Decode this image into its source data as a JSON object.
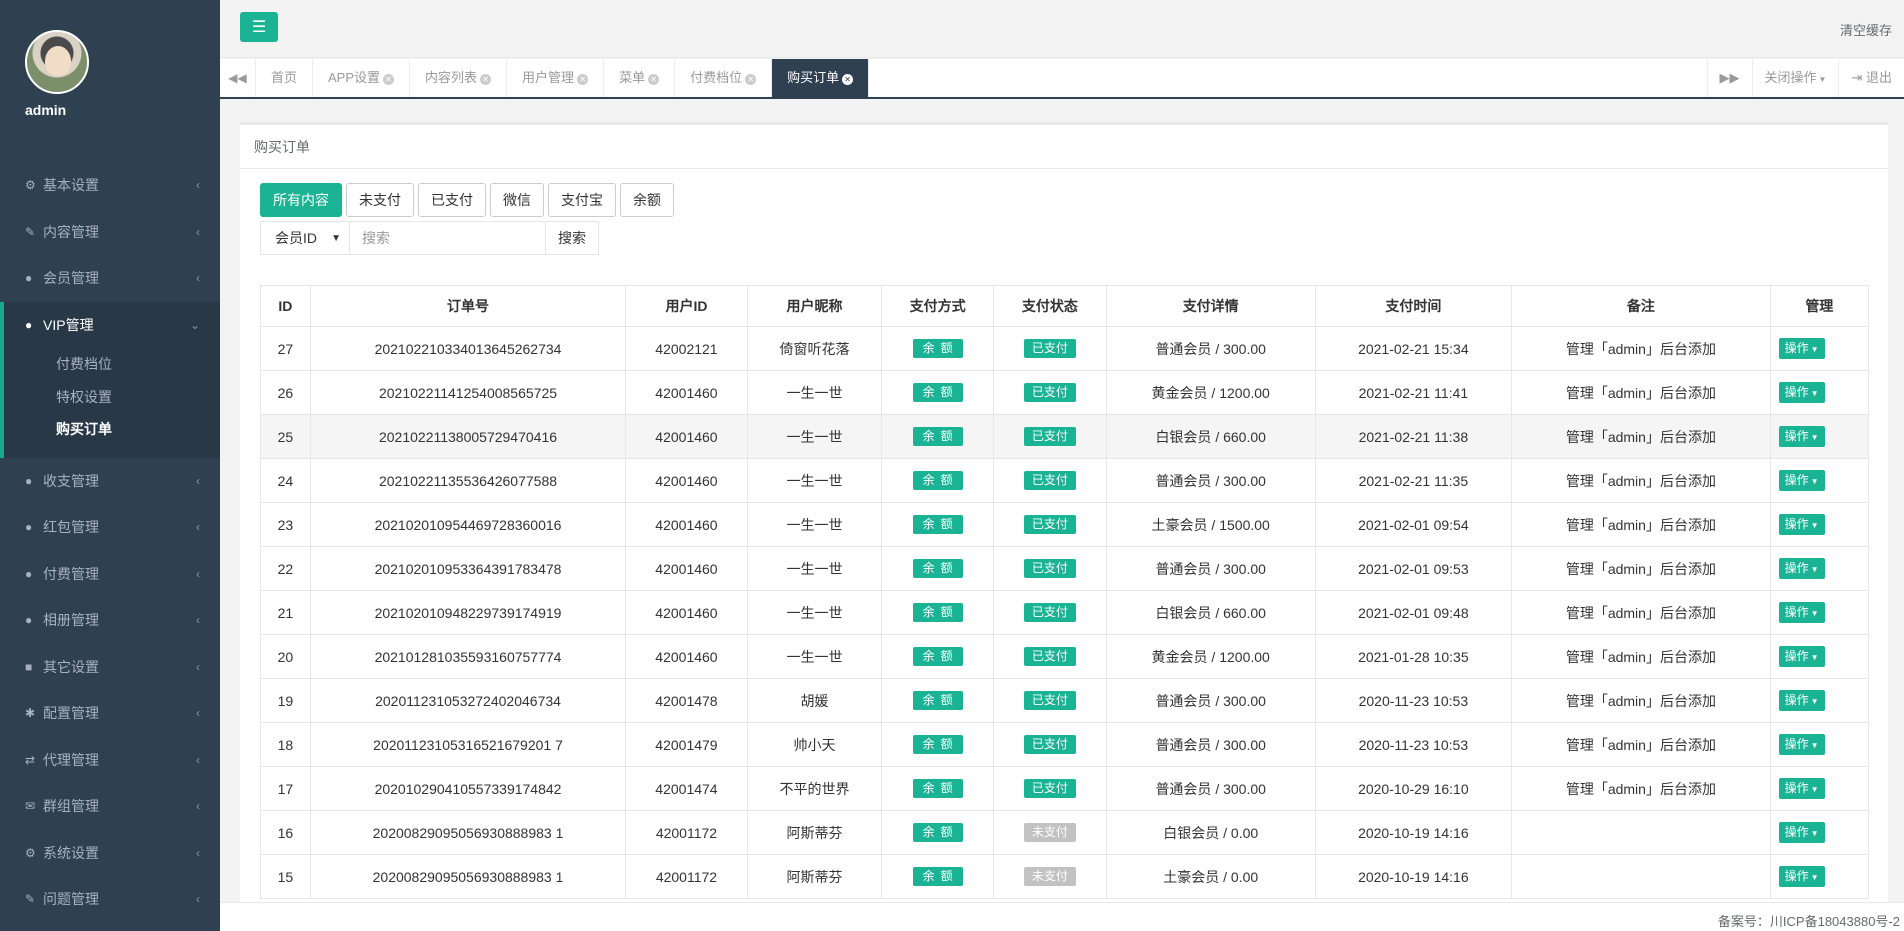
{
  "profile": {
    "name": "admin"
  },
  "sidebar": {
    "items_before": [
      {
        "label": "基本设置",
        "icon": "gear-icon",
        "glyph": "⚙"
      },
      {
        "label": "内容管理",
        "icon": "edit-icon",
        "glyph": "✎"
      },
      {
        "label": "会员管理",
        "icon": "user-icon",
        "glyph": "●"
      }
    ],
    "active_group": {
      "label": "VIP管理",
      "icon": "user-icon",
      "glyph": "●",
      "children": [
        {
          "label": "付费档位"
        },
        {
          "label": "特权设置"
        },
        {
          "label": "购买订单",
          "current": true
        }
      ]
    },
    "items_after": [
      {
        "label": "收支管理",
        "icon": "user-icon",
        "glyph": "●"
      },
      {
        "label": "红包管理",
        "icon": "user-icon",
        "glyph": "●"
      },
      {
        "label": "付费管理",
        "icon": "user-icon",
        "glyph": "●"
      },
      {
        "label": "相册管理",
        "icon": "user-icon",
        "glyph": "●"
      },
      {
        "label": "其它设置",
        "icon": "book-icon",
        "glyph": "■"
      },
      {
        "label": "配置管理",
        "icon": "asterisk-icon",
        "glyph": "✱"
      },
      {
        "label": "代理管理",
        "icon": "exchange-icon",
        "glyph": "⇄"
      },
      {
        "label": "群组管理",
        "icon": "chat-icon",
        "glyph": "✉"
      },
      {
        "label": "系统设置",
        "icon": "cogs-icon",
        "glyph": "⚙"
      },
      {
        "label": "问题管理",
        "icon": "edit-icon",
        "glyph": "✎"
      }
    ]
  },
  "topbar": {
    "clear_cache": "清空缓存"
  },
  "tabs": [
    {
      "label": "首页",
      "closable": false
    },
    {
      "label": "APP设置",
      "closable": true
    },
    {
      "label": "内容列表",
      "closable": true
    },
    {
      "label": "用户管理",
      "closable": true
    },
    {
      "label": "菜单",
      "closable": true
    },
    {
      "label": "付费档位",
      "closable": true
    },
    {
      "label": "购买订单",
      "closable": true,
      "active": true
    }
  ],
  "tabs_right": {
    "close_ops": "关闭操作",
    "logout": "退出"
  },
  "panel": {
    "title": "购买订单"
  },
  "filters": [
    "所有内容",
    "未支付",
    "已支付",
    "微信",
    "支付宝",
    "余额"
  ],
  "search": {
    "field": "会员ID",
    "placeholder": "搜索",
    "button": "搜索"
  },
  "table": {
    "headers": [
      "ID",
      "订单号",
      "用户ID",
      "用户昵称",
      "支付方式",
      "支付状态",
      "支付详情",
      "支付时间",
      "备注",
      "管理"
    ],
    "op_label": "操作",
    "rows": [
      {
        "id": "27",
        "order": "202102210334013645262734",
        "uid": "42002121",
        "nick": "倚窗听花落",
        "pay": "余额",
        "status": "已支付",
        "paid": true,
        "detail": "普通会员 / 300.00",
        "time": "2021-02-21 15:34",
        "note": "管理「admin」后台添加"
      },
      {
        "id": "26",
        "order": "20210221141254008565725",
        "uid": "42001460",
        "nick": "一生一世",
        "pay": "余额",
        "status": "已支付",
        "paid": true,
        "detail": "黄金会员 / 1200.00",
        "time": "2021-02-21 11:41",
        "note": "管理「admin」后台添加"
      },
      {
        "id": "25",
        "order": "20210221138005729470416",
        "uid": "42001460",
        "nick": "一生一世",
        "pay": "余额",
        "status": "已支付",
        "paid": true,
        "detail": "白银会员 / 660.00",
        "time": "2021-02-21 11:38",
        "note": "管理「admin」后台添加"
      },
      {
        "id": "24",
        "order": "20210221135536426077588",
        "uid": "42001460",
        "nick": "一生一世",
        "pay": "余额",
        "status": "已支付",
        "paid": true,
        "detail": "普通会员 / 300.00",
        "time": "2021-02-21 11:35",
        "note": "管理「admin」后台添加"
      },
      {
        "id": "23",
        "order": "202102010954469728360016",
        "uid": "42001460",
        "nick": "一生一世",
        "pay": "余额",
        "status": "已支付",
        "paid": true,
        "detail": "土豪会员 / 1500.00",
        "time": "2021-02-01 09:54",
        "note": "管理「admin」后台添加"
      },
      {
        "id": "22",
        "order": "202102010953364391783478",
        "uid": "42001460",
        "nick": "一生一世",
        "pay": "余额",
        "status": "已支付",
        "paid": true,
        "detail": "普通会员 / 300.00",
        "time": "2021-02-01 09:53",
        "note": "管理「admin」后台添加"
      },
      {
        "id": "21",
        "order": "202102010948229739174919",
        "uid": "42001460",
        "nick": "一生一世",
        "pay": "余额",
        "status": "已支付",
        "paid": true,
        "detail": "白银会员 / 660.00",
        "time": "2021-02-01 09:48",
        "note": "管理「admin」后台添加"
      },
      {
        "id": "20",
        "order": "202101281035593160757774",
        "uid": "42001460",
        "nick": "一生一世",
        "pay": "余额",
        "status": "已支付",
        "paid": true,
        "detail": "黄金会员 / 1200.00",
        "time": "2021-01-28 10:35",
        "note": "管理「admin」后台添加"
      },
      {
        "id": "19",
        "order": "202011231053272402046734",
        "uid": "42001478",
        "nick": "胡媛",
        "pay": "余额",
        "status": "已支付",
        "paid": true,
        "detail": "普通会员 / 300.00",
        "time": "2020-11-23 10:53",
        "note": "管理「admin」后台添加"
      },
      {
        "id": "18",
        "order": "20201123105316521679201 7",
        "uid": "42001479",
        "nick": "帅小天",
        "pay": "余额",
        "status": "已支付",
        "paid": true,
        "detail": "普通会员 / 300.00",
        "time": "2020-11-23 10:53",
        "note": "管理「admin」后台添加"
      },
      {
        "id": "17",
        "order": "202010290410557339174842",
        "uid": "42001474",
        "nick": "不平的世界",
        "pay": "余额",
        "status": "已支付",
        "paid": true,
        "detail": "普通会员 / 300.00",
        "time": "2020-10-29 16:10",
        "note": "管理「admin」后台添加"
      },
      {
        "id": "16",
        "order": "20200829095056930888983 1",
        "uid": "42001172",
        "nick": "阿斯蒂芬",
        "pay": "余额",
        "status": "未支付",
        "paid": false,
        "detail": "白银会员 / 0.00",
        "time": "2020-10-19 14:16",
        "note": ""
      },
      {
        "id": "15",
        "order": "20200829095056930888983 1",
        "uid": "42001172",
        "nick": "阿斯蒂芬",
        "pay": "余额",
        "status": "未支付",
        "paid": false,
        "detail": "土豪会员 / 0.00",
        "time": "2020-10-19 14:16",
        "note": ""
      }
    ]
  },
  "footer": {
    "icp": "备案号：川ICP备18043880号-2"
  },
  "colors": {
    "accent": "#1ab394",
    "sidebar": "#2f4050",
    "unpaid": "#c2c2c2"
  }
}
